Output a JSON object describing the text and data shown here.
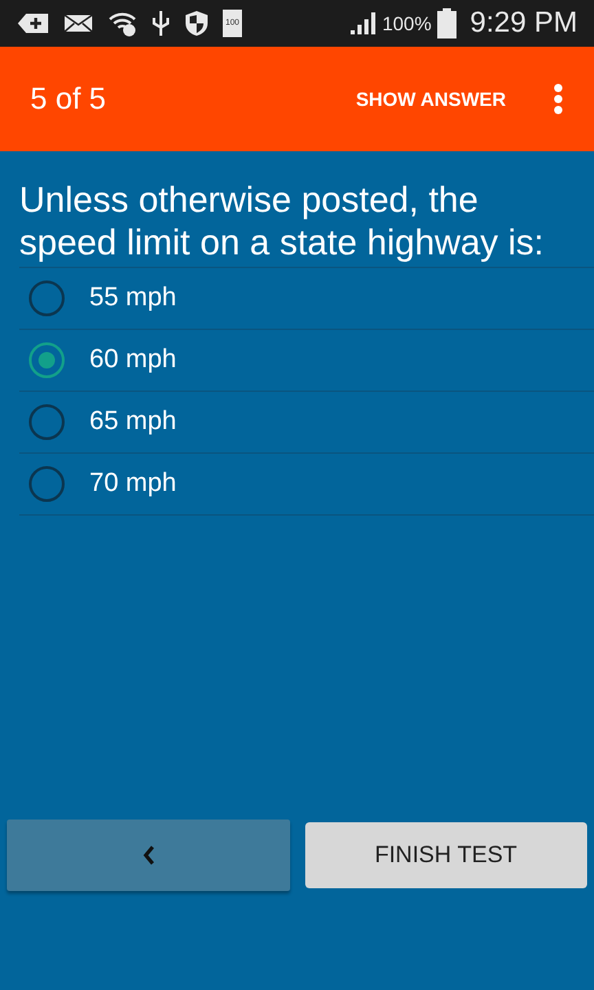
{
  "status_bar": {
    "battery_icon_text": "100",
    "battery_percent": "100%",
    "time": "9:29 PM"
  },
  "app_bar": {
    "title": "5 of 5",
    "action": "SHOW ANSWER"
  },
  "question": "Unless otherwise posted, the speed limit on a state highway is:",
  "options": [
    {
      "label": "55 mph",
      "selected": false
    },
    {
      "label": "60 mph",
      "selected": true
    },
    {
      "label": "65 mph",
      "selected": false
    },
    {
      "label": "70 mph",
      "selected": false
    }
  ],
  "buttons": {
    "finish": "FINISH TEST"
  }
}
